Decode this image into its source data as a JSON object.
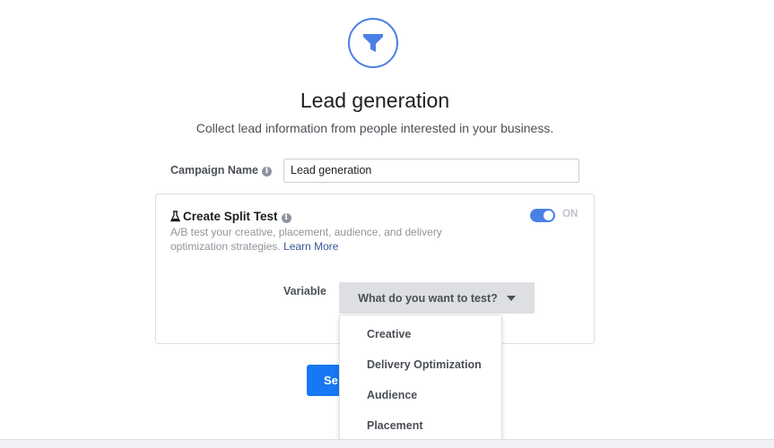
{
  "header": {
    "icon": "funnel-icon",
    "title": "Lead generation",
    "subtitle": "Collect lead information from people interested in your business."
  },
  "campaign_name": {
    "label": "Campaign Name",
    "value": "Lead generation",
    "info_icon": "info-icon"
  },
  "split_test": {
    "icon": "flask-icon",
    "title": "Create Split Test",
    "description": "A/B test your creative, placement, audience, and delivery optimization strategies.",
    "learn_more": "Learn More",
    "toggle_state": "ON",
    "toggle_on": true
  },
  "variable": {
    "label": "Variable",
    "placeholder": "What do you want to test?",
    "options": [
      "Creative",
      "Delivery Optimization",
      "Audience",
      "Placement"
    ]
  },
  "footer": {
    "button_label": "Se"
  },
  "colors": {
    "accent": "#4a7fe5",
    "button": "#1877f2",
    "link": "#385898"
  }
}
